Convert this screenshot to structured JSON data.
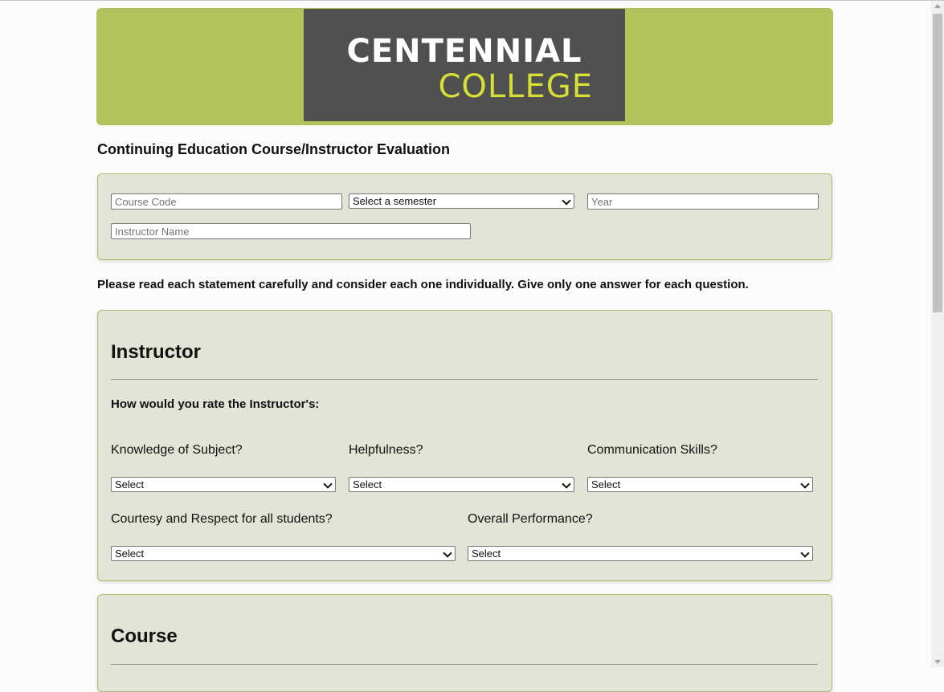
{
  "logo": {
    "line1": "CENTENNIAL",
    "line2": "COLLEGE"
  },
  "page_title": "Continuing Education Course/Instructor Evaluation",
  "info": {
    "course_code_placeholder": "Course Code",
    "semester_selected": "Select a semester",
    "year_placeholder": "Year",
    "instructor_name_placeholder": "Instructor Name"
  },
  "instructions": "Please read each statement carefully and consider each one individually. Give only one answer for each question.",
  "instructor_section": {
    "heading": "Instructor",
    "lead": "How would you rate the Instructor's:",
    "questions": [
      {
        "label": "Knowledge of Subject?",
        "selected": "Select"
      },
      {
        "label": "Helpfulness?",
        "selected": "Select"
      },
      {
        "label": "Communication Skills?",
        "selected": "Select"
      },
      {
        "label": "Courtesy and Respect for all students?",
        "selected": "Select"
      },
      {
        "label": "Overall Performance?",
        "selected": "Select"
      }
    ]
  },
  "course_section": {
    "heading": "Course"
  },
  "colors": {
    "banner": "#b3c25c",
    "logo_bg": "#505050",
    "logo_accent": "#d7df36",
    "panel": "#e2e4d6",
    "panel_border": "#a9bd6e"
  }
}
